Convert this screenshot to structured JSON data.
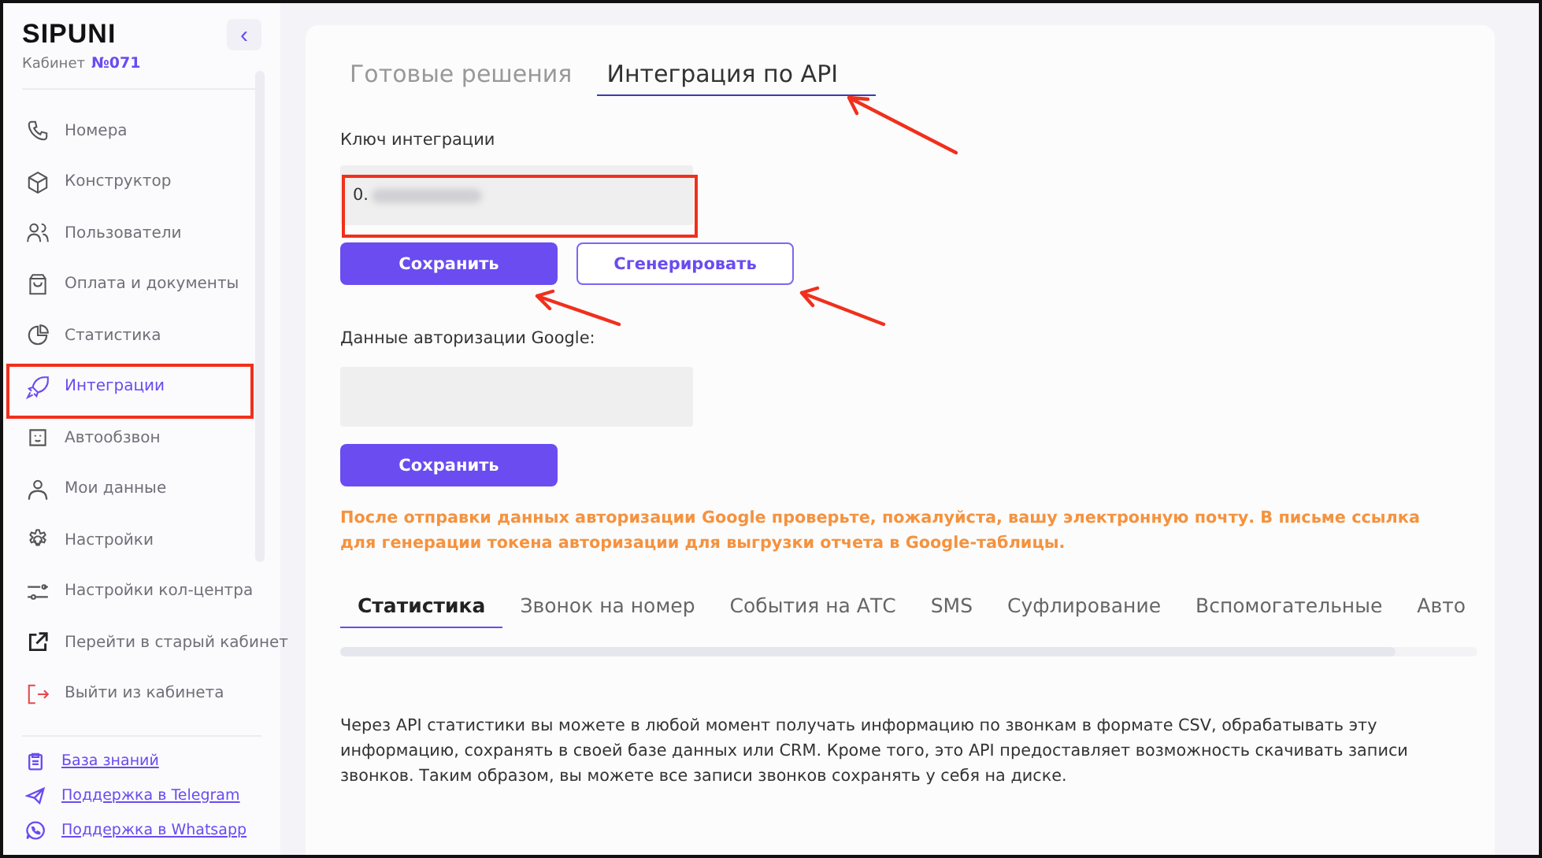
{
  "sidebar": {
    "logo": "SIPUNI",
    "collapse": "‹",
    "cabinet_label": "Кабинет",
    "cabinet_number": "№071",
    "items": [
      {
        "label": "Номера",
        "selected": false
      },
      {
        "label": "Конструктор",
        "selected": false
      },
      {
        "label": "Пользователи",
        "selected": false
      },
      {
        "label": "Оплата и документы",
        "selected": false
      },
      {
        "label": "Статистика",
        "selected": false
      },
      {
        "label": "Интеграции",
        "selected": true
      },
      {
        "label": "Автообзвон",
        "selected": false
      },
      {
        "label": "Мои данные",
        "selected": false
      },
      {
        "label": "Настройки",
        "selected": false
      },
      {
        "label": "Настройки кол-центра",
        "selected": false
      },
      {
        "label": "Перейти в старый кабинет",
        "selected": false
      },
      {
        "label": "Выйти из кабинета",
        "selected": false
      }
    ],
    "links": [
      "База знаний",
      "Поддержка в Telegram",
      "Поддержка в Whatsapp"
    ]
  },
  "tabs": [
    {
      "label": "Готовые решения",
      "selected": false
    },
    {
      "label": "Интеграция по API",
      "selected": true
    }
  ],
  "key_label": "Ключ интеграции",
  "key_value": "0.",
  "save_button": "Сохранить",
  "generate_button": "Сгенерировать",
  "google_label": "Данные авторизации Google:",
  "google_save_button": "Сохранить",
  "notice": "После отправки данных авторизации Google проверьте, пожалуйста, вашу электронную почту. В письме ссылка для генерации токена авторизации для выгрузки отчета в Google-таблицы.",
  "api_tabs": [
    {
      "label": "Статистика",
      "selected": true
    },
    {
      "label": "Звонок на номер",
      "selected": false
    },
    {
      "label": "События на АТС",
      "selected": false
    },
    {
      "label": "SMS",
      "selected": false
    },
    {
      "label": "Суфлирование",
      "selected": false
    },
    {
      "label": "Вспомогательные",
      "selected": false
    },
    {
      "label": "Авто",
      "selected": false
    }
  ],
  "description": "Через API статистики вы можете в любой момент получать информацию по звонкам в формате CSV, обрабатывать эту информацию, сохранять в своей базе данных или CRM. Кроме того, это API предоставляет возможность скачивать записи звонков. Таким образом, вы можете все записи звонков сохранять у себя на диске."
}
